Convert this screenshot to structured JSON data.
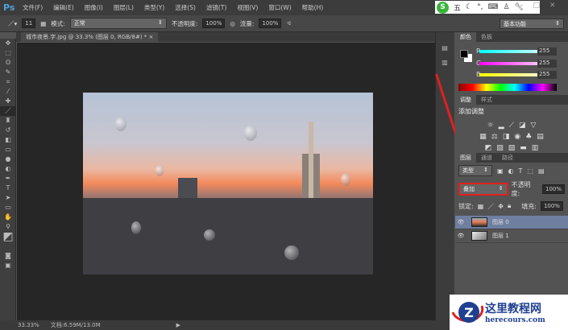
{
  "app": {
    "logo": "Ps"
  },
  "menu": [
    "文件(F)",
    "编辑(E)",
    "图像(I)",
    "图层(L)",
    "类型(Y)",
    "选择(S)",
    "滤镜(T)",
    "视图(V)",
    "窗口(W)",
    "帮助(H)"
  ],
  "ime": {
    "logo": "S",
    "mode": "五"
  },
  "options": {
    "brush_size": "11",
    "mode_label": "模式:",
    "mode_value": "正常",
    "opacity_label": "不透明度:",
    "opacity_value": "100%",
    "flow_label": "流量:",
    "flow_value": "100%",
    "workspace": "基本功能"
  },
  "document": {
    "tab": "城市夜景.字.jpg @ 33.3% (图层 0, RGB/8#) *",
    "close": "×"
  },
  "color_panel": {
    "tabs": [
      "颜色",
      "色板"
    ],
    "r_label": "R",
    "g_label": "G",
    "b_label": "B",
    "r": "255",
    "g": "255",
    "b": "255"
  },
  "adjust_panel": {
    "tabs": [
      "调整",
      "样式"
    ],
    "title": "添加调整"
  },
  "layers_panel": {
    "tabs": [
      "图层",
      "通道",
      "路径"
    ],
    "filter": "类型",
    "blend_mode": "叠加",
    "opacity_label": "不透明度:",
    "opacity": "100%",
    "lock_label": "锁定:",
    "fill_label": "填充:",
    "fill": "100%",
    "layers": [
      {
        "name": "图层 0",
        "selected": true
      },
      {
        "name": "图层 1",
        "selected": false
      }
    ]
  },
  "status": {
    "zoom": "33.33%",
    "doc": "文档:6.59M/13.0M"
  },
  "watermark": {
    "title": "这里教程网",
    "url": "herecours.com"
  },
  "colors": {
    "highlight": "#e02020",
    "accent": "#4ea3e0"
  }
}
